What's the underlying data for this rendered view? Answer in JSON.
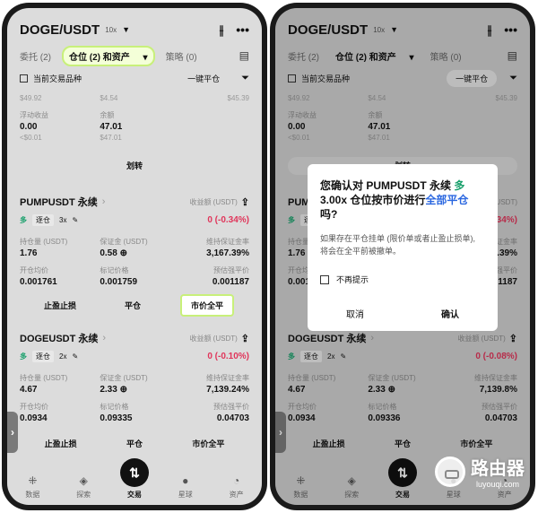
{
  "header": {
    "pair": "DOGE/USDT",
    "leverage": "10x"
  },
  "tabs": {
    "orders": "委托 (2)",
    "positions": "仓位 (2) 和资产",
    "strategy": "策略 (0)"
  },
  "filter": {
    "current_only": "当前交易品种",
    "close_all": "一键平仓"
  },
  "top_section": {
    "prev_row": {
      "a": "$49.92",
      "b": "$4.54",
      "c": "$45.39"
    },
    "floating_pnl_label": "浮动收益",
    "floating_pnl": "0.00",
    "floating_pnl_usd": "<$0.01",
    "balance_label": "余额",
    "balance": "47.01",
    "balance_usd": "$47.01",
    "transfer": "划转"
  },
  "positions": [
    {
      "symbol": "PUMPUSDT 永续",
      "pnl_label": "收益额 (USDT)",
      "direction": "多",
      "mode": "逐仓",
      "leverage": "3x",
      "pnl_left": "0 (-0.34%)",
      "pnl_right": "0 (-0.34%)",
      "size_label": "持仓量 (USDT)",
      "size": "1.76",
      "margin_label": "保证金 (USDT)",
      "margin": "0.58",
      "mmr_label": "维持保证金率",
      "mmr": "3,167.39%",
      "entry_label": "开仓均价",
      "entry": "0.001761",
      "mark_label": "标记价格",
      "mark": "0.001759",
      "liq_label": "预估强平价",
      "liq": "0.001187"
    },
    {
      "symbol": "DOGEUSDT 永续",
      "pnl_label": "收益额 (USDT)",
      "direction": "多",
      "mode": "逐仓",
      "leverage": "2x",
      "pnl_left": "0 (-0.10%)",
      "pnl_right": "0 (-0.08%)",
      "size_label": "持仓量 (USDT)",
      "size": "4.67",
      "margin_label": "保证金 (USDT)",
      "margin": "2.33",
      "mmr_label": "维持保证金率",
      "mmr_left": "7,139.24%",
      "mmr_right": "7,139.8%",
      "entry_label": "开仓均价",
      "entry": "0.0934",
      "mark_label": "标记价格",
      "mark_left": "0.09335",
      "mark_right": "0.09336",
      "liq_label": "预估强平价",
      "liq": "0.04703"
    }
  ],
  "actions": {
    "tp_sl": "止盈止损",
    "close": "平仓",
    "market_close_all": "市价全平"
  },
  "nav": {
    "data": "数据",
    "explore": "探索",
    "trade": "交易",
    "planet": "星球",
    "assets": "资产"
  },
  "dialog": {
    "title_a": "您确认对 PUMPUSDT 永续 ",
    "title_long": "多",
    "title_b": " 3.00x 仓位按市价进行",
    "title_all": "全部平仓",
    "title_c": "吗?",
    "body": "如果存在平仓挂单 (限价单或者止盈止损单), 将会在全平前被撤单。",
    "no_remind": "不再提示",
    "cancel": "取消",
    "confirm": "确认"
  },
  "watermark": {
    "cn": "路由器",
    "en": "luyouqi.com"
  }
}
